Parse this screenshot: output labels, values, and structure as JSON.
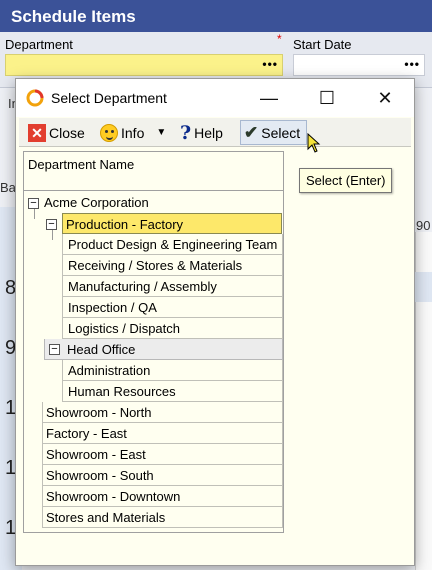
{
  "background": {
    "header_title": "Schedule Items",
    "department_label": "Department",
    "required_marker": "*",
    "start_date_label": "Start Date",
    "dots": "•••",
    "fragments": [
      "In",
      "Ba",
      "90"
    ],
    "row_numbers": [
      "8",
      "9",
      "1",
      "1",
      "1"
    ]
  },
  "dialog": {
    "title": "Select Department",
    "window_controls": {
      "minimize": "—",
      "maximize": "☐",
      "close": "✕"
    },
    "toolbar": {
      "close_label": "Close",
      "info_label": "Info",
      "help_label": "Help",
      "select_label": "Select"
    },
    "grid": {
      "column_header": "Department Name",
      "rows": [
        {
          "label": "Acme Corporation",
          "level": 0,
          "expander": "−"
        },
        {
          "label": "Production - Factory",
          "level": 1,
          "expander": "−",
          "selected": true
        },
        {
          "label": "Product Design & Engineering Team",
          "level": 2
        },
        {
          "label": "Receiving / Stores & Materials",
          "level": 2
        },
        {
          "label": "Manufacturing / Assembly",
          "level": 2
        },
        {
          "label": "Inspection / QA",
          "level": 2
        },
        {
          "label": "Logistics / Dispatch",
          "level": 2
        },
        {
          "label": "Head Office",
          "level": 1,
          "expander": "−"
        },
        {
          "label": "Administration",
          "level": 2
        },
        {
          "label": "Human Resources",
          "level": 2
        },
        {
          "label": "Showroom - North",
          "level": 0
        },
        {
          "label": "Factory - East",
          "level": 0
        },
        {
          "label": "Showroom - East",
          "level": 0
        },
        {
          "label": "Showroom - South",
          "level": 0
        },
        {
          "label": "Showroom - Downtown",
          "level": 0
        },
        {
          "label": "Stores and Materials",
          "level": 0
        }
      ]
    },
    "tooltip": "Select (Enter)"
  },
  "colors": {
    "header_bg": "#3b5298",
    "selected_row": "#fde86a",
    "dialog_bg": "#fffff0",
    "dept_field_bg": "#fbf28a"
  }
}
